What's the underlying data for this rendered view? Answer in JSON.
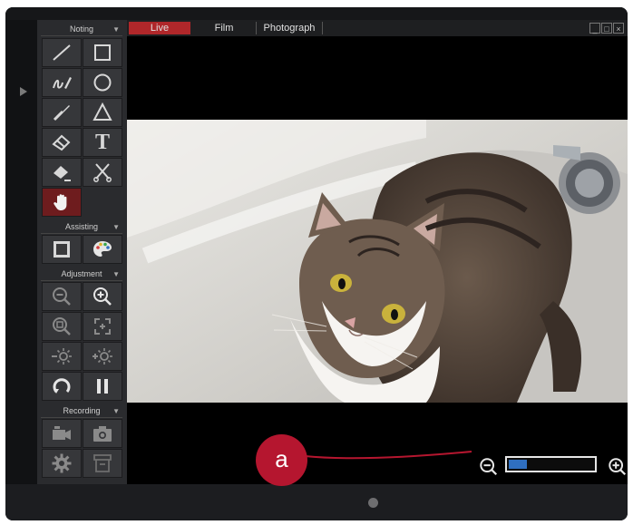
{
  "tabs": [
    {
      "label": "Live",
      "active": true
    },
    {
      "label": "Film",
      "active": false
    },
    {
      "label": "Photograph",
      "active": false
    }
  ],
  "window_controls": {
    "minimize": "_",
    "restore": "□",
    "close": "×"
  },
  "sections": {
    "noting": "Noting",
    "assisting": "Assisting",
    "adjustment": "Adjustment",
    "recording": "Recording"
  },
  "tools": {
    "noting": [
      "line-icon",
      "rectangle-icon",
      "freehand-pen-icon",
      "circle-icon",
      "brush-icon",
      "triangle-icon",
      "eraser-icon",
      "text-icon",
      "clear-eraser-icon",
      "scissors-icon",
      "hand-icon"
    ],
    "assisting": [
      "square-frame-icon",
      "color-palette-icon"
    ],
    "adjustment": [
      "zoom-out-icon",
      "zoom-in-icon",
      "zoom-fit-icon",
      "zoom-full-icon",
      "brightness-down-icon",
      "brightness-up-icon",
      "rotate-icon",
      "pause-icon"
    ],
    "recording": [
      "video-camera-icon",
      "photo-camera-icon",
      "settings-gear-icon",
      "archive-icon"
    ]
  },
  "active_tool": "hand-icon",
  "text_tool_glyph": "T",
  "callout": {
    "label": "a"
  },
  "zoom": {
    "level": 0.22
  },
  "colors": {
    "accent": "#b0272a",
    "callout": "#b5162f",
    "zoom_fill": "#2f6fc0",
    "panel": "#2a2b2e"
  }
}
